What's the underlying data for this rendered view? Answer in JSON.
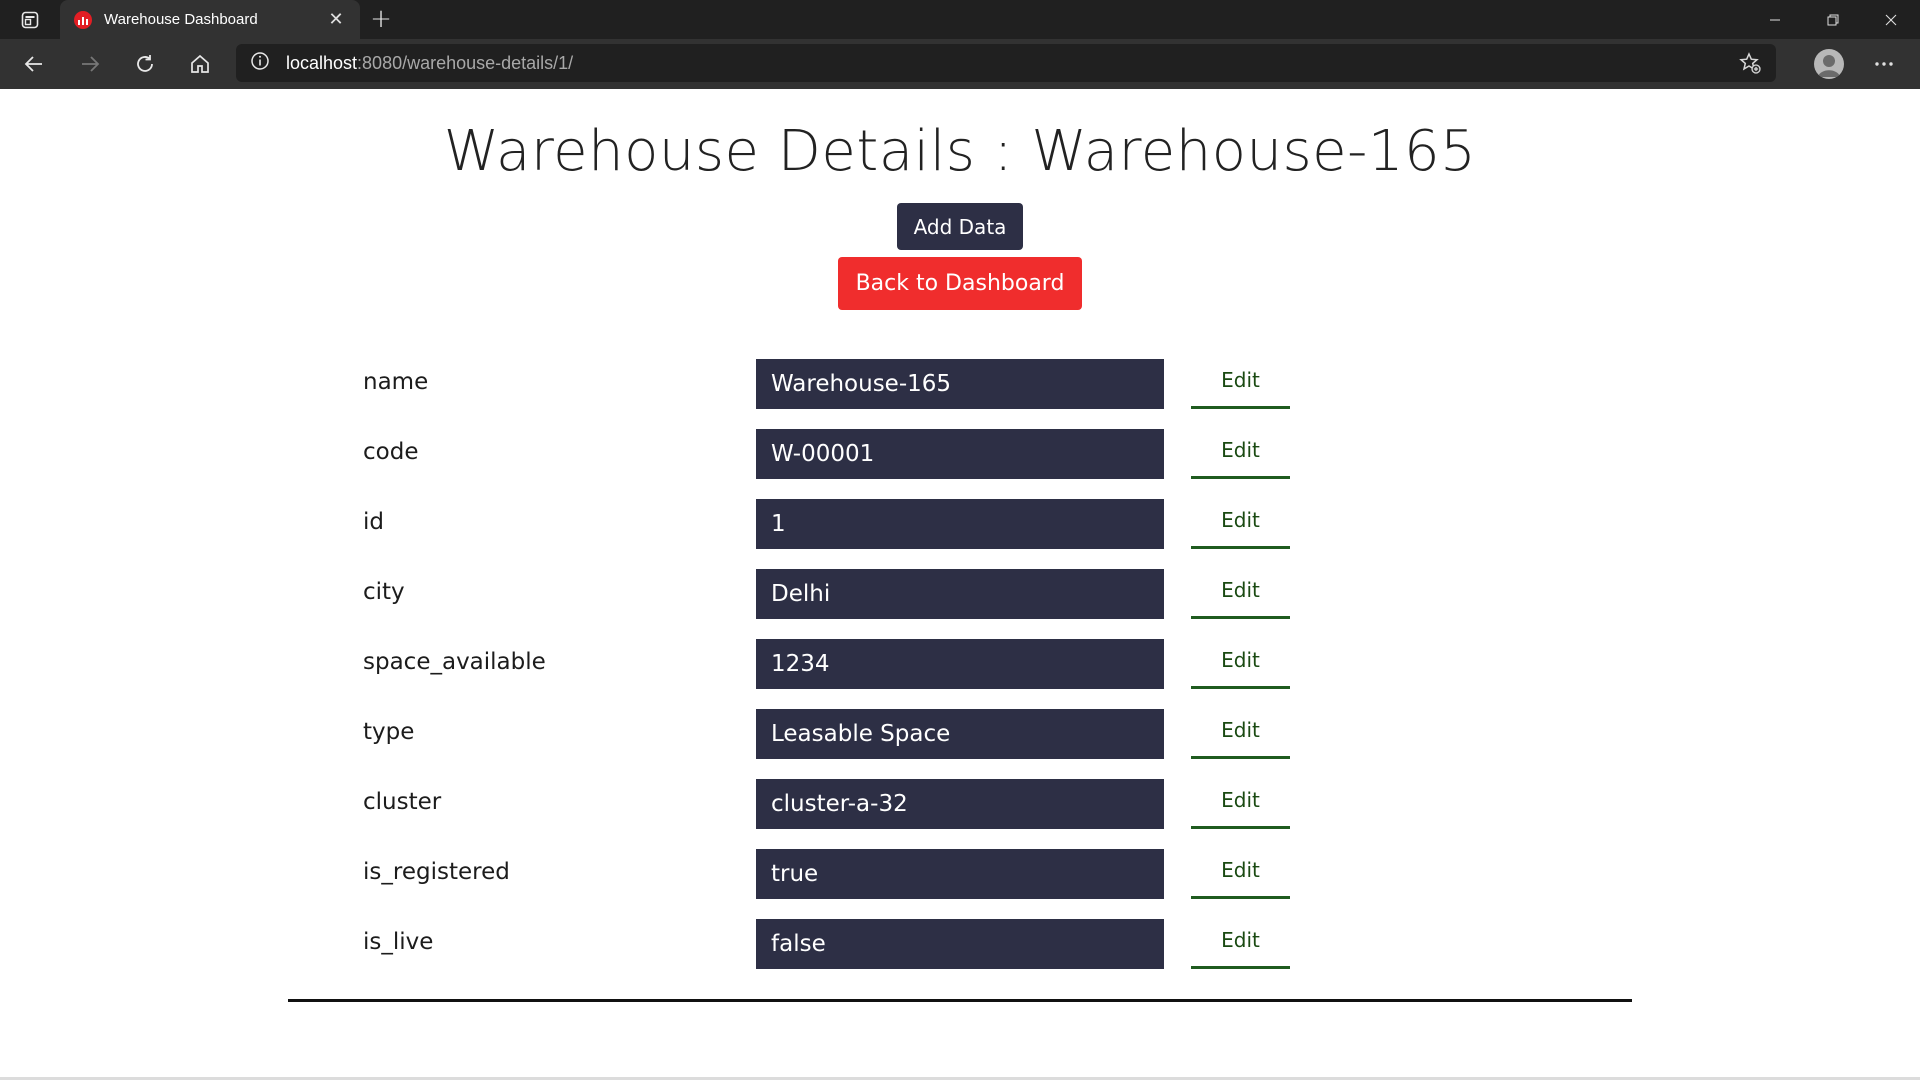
{
  "browser": {
    "tab_title": "Warehouse Dashboard",
    "tab_close": "✕",
    "new_tab": "+",
    "url_host": "localhost",
    "url_path": ":8080/warehouse-details/1/"
  },
  "page": {
    "title": "Warehouse Details : Warehouse-165",
    "add_button": "Add Data",
    "back_button": "Back to Dashboard",
    "edit_label": "Edit",
    "fields": [
      {
        "label": "name",
        "value": "Warehouse-165"
      },
      {
        "label": "code",
        "value": "W-00001"
      },
      {
        "label": "id",
        "value": "1"
      },
      {
        "label": "city",
        "value": "Delhi"
      },
      {
        "label": "space_available",
        "value": "1234"
      },
      {
        "label": "type",
        "value": "Leasable Space"
      },
      {
        "label": "cluster",
        "value": "cluster-a-32"
      },
      {
        "label": "is_registered",
        "value": "true"
      },
      {
        "label": "is_live",
        "value": "false"
      }
    ]
  },
  "colors": {
    "dark_navy": "#2d2f45",
    "red": "#f02d2d",
    "edit_green": "#1f5b1f"
  }
}
